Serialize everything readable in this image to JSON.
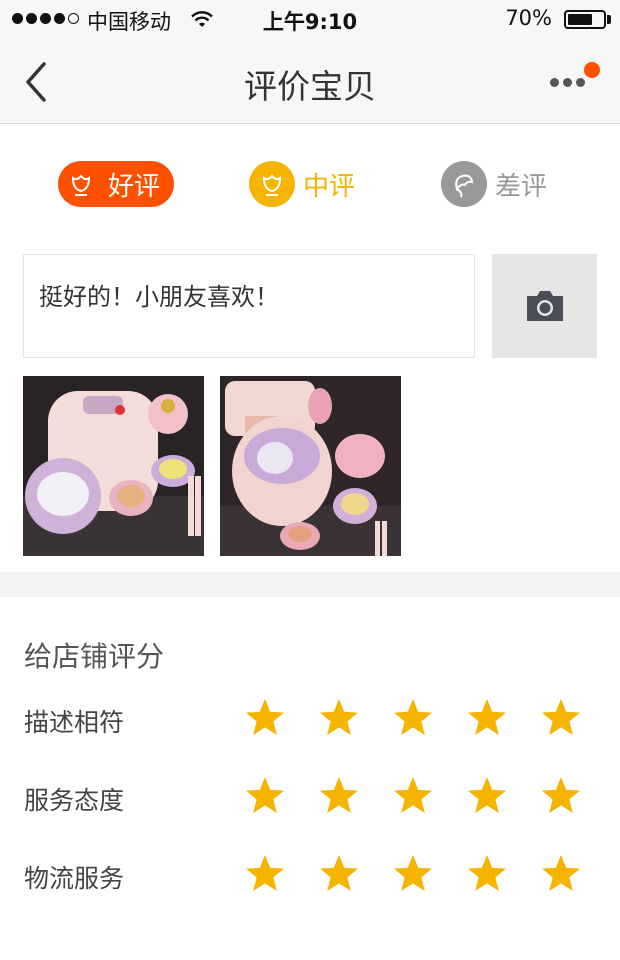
{
  "status_bar": {
    "carrier": "中国移动",
    "time": "上午9:10",
    "battery": "70%",
    "battery_level": 0.7
  },
  "nav": {
    "title": "评价宝贝"
  },
  "rating_options": {
    "good": "好评",
    "neutral": "中评",
    "bad": "差评",
    "selected": "good"
  },
  "review": {
    "text": "挺好的！小朋友喜欢！"
  },
  "store_rating": {
    "title": "给店铺评分",
    "rows": [
      {
        "label": "描述相符",
        "stars": 5
      },
      {
        "label": "服务态度",
        "stars": 5
      },
      {
        "label": "物流服务",
        "stars": 5
      }
    ],
    "star_color": "#f5b400"
  },
  "colors": {
    "accent": "#ff5000",
    "neutral": "#f5b400",
    "bad": "#999999"
  }
}
